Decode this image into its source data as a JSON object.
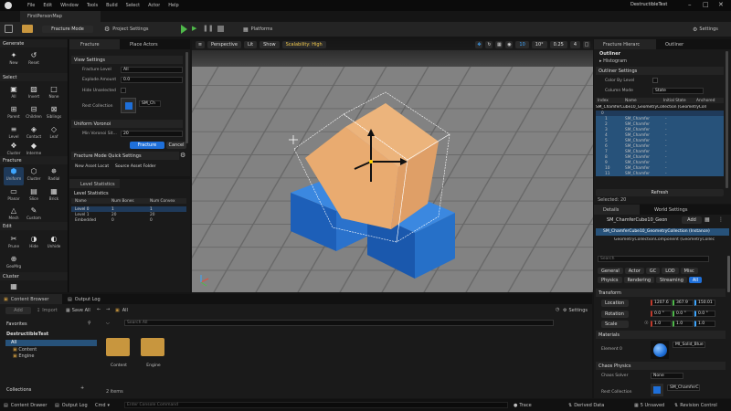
{
  "window": {
    "title": "DestructibleTest",
    "tab": "FirstPersonMap"
  },
  "menu": [
    "File",
    "Edit",
    "Window",
    "Tools",
    "Build",
    "Select",
    "Actor",
    "Help"
  ],
  "toolbar": {
    "mode": "Fracture Mode",
    "project_settings": "Project Settings",
    "platforms": "Platforms",
    "settings": "Settings"
  },
  "left_toolbox": {
    "sections": {
      "generate": "Generate",
      "select": "Select",
      "fracture": "Fracture",
      "edit": "Edit",
      "cluster": "Cluster"
    },
    "generate": [
      {
        "label": "New",
        "icon": "✦"
      },
      {
        "label": "Reset",
        "icon": "↺"
      }
    ],
    "select": [
      {
        "label": "All",
        "icon": "▣"
      },
      {
        "label": "Invert",
        "icon": "▨"
      },
      {
        "label": "None",
        "icon": "□"
      },
      {
        "label": "Parent",
        "icon": "⊞"
      },
      {
        "label": "Children",
        "icon": "⊟"
      },
      {
        "label": "Siblings",
        "icon": "⊠"
      },
      {
        "label": "Level",
        "icon": "≡"
      },
      {
        "label": "Contact",
        "icon": "◈"
      },
      {
        "label": "Leaf",
        "icon": "◇"
      },
      {
        "label": "Cluster",
        "icon": "❖"
      },
      {
        "label": "Interme",
        "icon": "◆"
      }
    ],
    "fracture": [
      {
        "label": "Uniform",
        "icon": "⬢"
      },
      {
        "label": "Cluster",
        "icon": "⬡"
      },
      {
        "label": "Radial",
        "icon": "✵"
      },
      {
        "label": "Planar",
        "icon": "▭"
      },
      {
        "label": "Slice",
        "icon": "▤"
      },
      {
        "label": "Brick",
        "icon": "▦"
      },
      {
        "label": "Mesh",
        "icon": "△"
      },
      {
        "label": "Custom",
        "icon": "✎"
      }
    ],
    "edit": [
      {
        "label": "Prune",
        "icon": "✂"
      },
      {
        "label": "Hide",
        "icon": "◑"
      },
      {
        "label": "Unhide",
        "icon": "◐"
      },
      {
        "label": "GeoMrg",
        "icon": "⊕"
      }
    ]
  },
  "fracture_panel": {
    "tab1": "Fracture",
    "tab2": "Place Actors",
    "view_settings": "View Settings",
    "fracture_level_label": "Fracture Level",
    "fracture_level_value": "All",
    "explode_label": "Explode Amount",
    "explode_value": "0.0",
    "hide_label": "Hide Unselected",
    "rest_label": "Rest Collection",
    "rest_value": "SM_Ch",
    "uniform_voronoi": "Uniform Voronoi",
    "min_sites_label": "Min Voronoi Sit...",
    "min_sites_value": "20",
    "fracture_btn": "Fracture",
    "cancel_btn": "Cancel",
    "quick_settings": "Fracture Mode Quick Settings",
    "new_asset_label": "New Asset Locat",
    "new_asset_value": "Source Asset Folder"
  },
  "level_stats": {
    "tab": "Level Statistics",
    "section": "Level Statistics",
    "headers": [
      "Name",
      "Num Bones",
      "Num Convex"
    ],
    "rows": [
      [
        "Level 0",
        "1",
        "1"
      ],
      [
        "Level 1",
        "20",
        "20"
      ],
      [
        "Embedded",
        "0",
        "0"
      ]
    ]
  },
  "viewport": {
    "perspective": "Perspective",
    "lit": "Lit",
    "show": "Show",
    "scalability": "Scalability: High",
    "grid": "10",
    "angle": "10°",
    "scale": "0.25",
    "cam": "4"
  },
  "outliner": {
    "tab1": "Fracture Hierarc",
    "tab2": "Outliner",
    "section_outliner": "Outliner",
    "histogram": "Histogram",
    "outliner_settings": "Outliner Settings",
    "color_by_level": "Color By Level",
    "column_mode_label": "Column Mode",
    "column_mode_value": "State",
    "headers": [
      "Index",
      "Name",
      "Initial State",
      "Anchored"
    ],
    "root": "SM_ChamferCube10_GeometryCollection (GeometryColl",
    "rows": [
      [
        "0",
        ""
      ],
      [
        "1",
        "SM_Chamfer"
      ],
      [
        "2",
        "SM_Chamfer"
      ],
      [
        "3",
        "SM_Chamfer"
      ],
      [
        "4",
        "SM_Chamfer"
      ],
      [
        "5",
        "SM_Chamfer"
      ],
      [
        "6",
        "SM_Chamfer"
      ],
      [
        "7",
        "SM_Chamfer"
      ],
      [
        "8",
        "SM_Chamfer"
      ],
      [
        "9",
        "SM_Chamfer"
      ],
      [
        "10",
        "SM_Chamfer"
      ],
      [
        "11",
        "SM_Chamfer"
      ]
    ],
    "state_dash": "-",
    "refresh": "Refresh",
    "selected": "Selected: 20"
  },
  "details": {
    "tab1": "Details",
    "tab2": "World Settings",
    "object": "SM_ChamferCube10_Geon",
    "add": "Add",
    "instance": "SM_ChamferCube10_GeometryCollection (Instance)",
    "component": "GeometryCollectionComponent (GeometryCollec",
    "search_placeholder": "Search",
    "filters_row1": [
      "General",
      "Actor",
      "GC",
      "LOD",
      "Misc"
    ],
    "filters_row2": [
      "Physics",
      "Rendering",
      "Streaming",
      "All"
    ],
    "transform": "Transform",
    "location_label": "Location",
    "location": [
      "1207.6",
      "367.9",
      "150.01"
    ],
    "rotation_label": "Rotation",
    "rotation": [
      "0.0 °",
      "0.0 °",
      "0.0 °"
    ],
    "scale_label": "Scale",
    "scale": [
      "1.0",
      "1.0",
      "1.0"
    ],
    "materials": "Materials",
    "element0": "Element 0",
    "material_name": "MI_Solid_Blue",
    "chaos": "Chaos Physics",
    "solver_label": "Chaos Solver",
    "solver_value": "None",
    "rest_label": "Rest Collection",
    "rest_value": "SM_ChamferC"
  },
  "content_browser": {
    "tab1": "Content Browser",
    "tab2": "Output Log",
    "add": "Add",
    "import": "Import",
    "save_all": "Save All",
    "all": "All",
    "settings": "Settings",
    "favorites": "Favorites",
    "project": "DestructibleTest",
    "tree": [
      "All",
      "Content",
      "Engine"
    ],
    "search_placeholder": "Search All",
    "folders": [
      "Content",
      "Engine"
    ],
    "count": "2 items",
    "collections": "Collections"
  },
  "statusbar": {
    "content_drawer": "Content Drawer",
    "output_log": "Output Log",
    "cmd": "Cmd",
    "console_placeholder": "Enter Console Command",
    "trace": "Trace",
    "derived": "Derived Data",
    "unsaved": "5 Unsaved",
    "revision": "Revision Control"
  }
}
